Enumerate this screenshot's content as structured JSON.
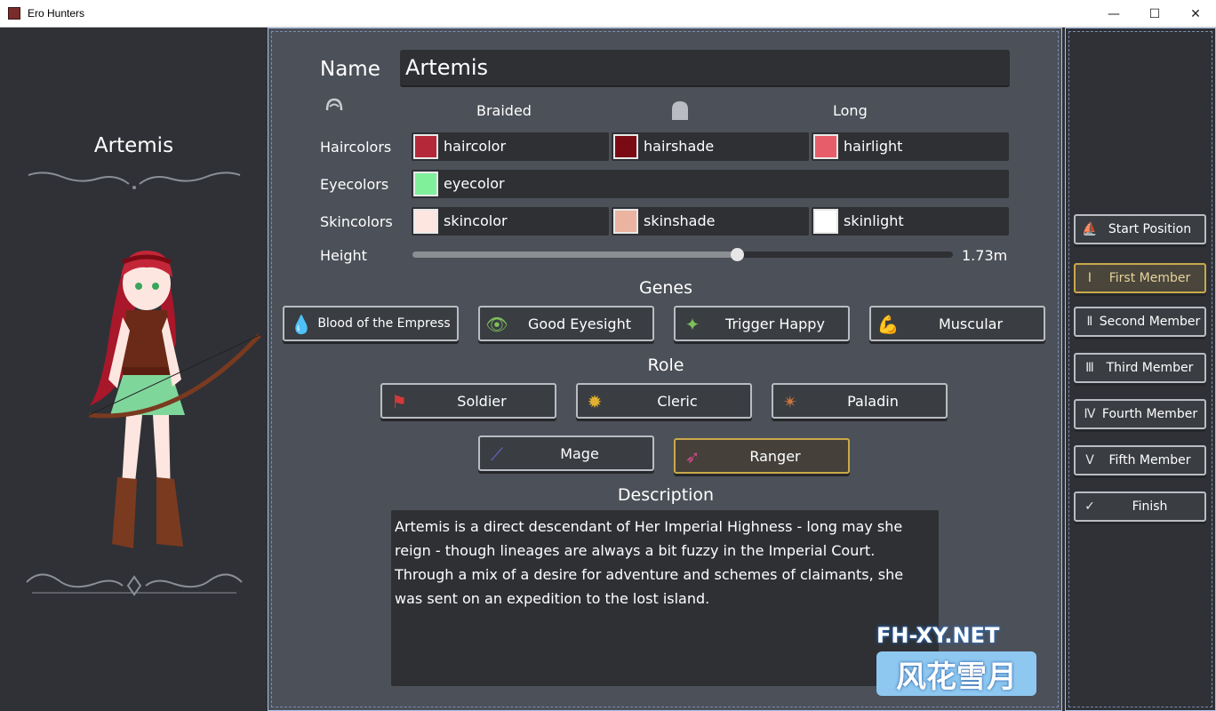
{
  "window": {
    "title": "Ero Hunters",
    "minimize": "—",
    "maximize": "☐",
    "close": "✕"
  },
  "left": {
    "character_name": "Artemis"
  },
  "form": {
    "name_label": "Name",
    "name_value": "Artemis",
    "hair_style_front": "Braided",
    "hair_style_back": "Long",
    "haircolors_label": "Haircolors",
    "haircolor": {
      "label": "haircolor",
      "color": "#b5283a"
    },
    "hairshade": {
      "label": "hairshade",
      "color": "#7a0b14"
    },
    "hairlight": {
      "label": "hairlight",
      "color": "#e85d6a"
    },
    "eyecolors_label": "Eyecolors",
    "eyecolor": {
      "label": "eyecolor",
      "color": "#80f09a"
    },
    "skincolors_label": "Skincolors",
    "skincolor": {
      "label": "skincolor",
      "color": "#fde6e0"
    },
    "skinshade": {
      "label": "skinshade",
      "color": "#eab4a0"
    },
    "skinlight": {
      "label": "skinlight",
      "color": "#ffffff"
    },
    "height_label": "Height",
    "height_value": "1.73m",
    "height_fraction": 0.6
  },
  "genes": {
    "title": "Genes",
    "items": [
      {
        "label": "Blood of the Empress",
        "icon": "blood-drop-icon",
        "color": "#4a8fe0"
      },
      {
        "label": "Good Eyesight",
        "icon": "eye-icon",
        "color": "#7ec05a"
      },
      {
        "label": "Trigger Happy",
        "icon": "pistol-icon",
        "color": "#7ec05a"
      },
      {
        "label": "Muscular",
        "icon": "arm-icon",
        "color": "#c9ccd1"
      }
    ]
  },
  "role": {
    "title": "Role",
    "items": [
      {
        "label": "Soldier",
        "icon": "banner-icon",
        "color": "#d03a3a"
      },
      {
        "label": "Cleric",
        "icon": "sun-icon",
        "color": "#e0b030"
      },
      {
        "label": "Paladin",
        "icon": "cross-sun-icon",
        "color": "#d0783a"
      },
      {
        "label": "Mage",
        "icon": "staff-icon",
        "color": "#6a6ad8"
      },
      {
        "label": "Ranger",
        "icon": "bow-icon",
        "color": "#d04a8a",
        "selected": true
      }
    ]
  },
  "description": {
    "title": "Description",
    "text": "Artemis is a direct descendant of Her Imperial Highness - long may she reign - though lineages are always a bit fuzzy in the Imperial Court. Through a mix of a desire for adventure and schemes of claimants, she was sent on an expedition to the lost island."
  },
  "party": {
    "items": [
      {
        "label": "Start Position",
        "icon": "ship-icon"
      },
      {
        "label": "First Member",
        "icon": "numeral-i-icon",
        "selected": true
      },
      {
        "label": "Second Member",
        "icon": "numeral-ii-icon"
      },
      {
        "label": "Third Member",
        "icon": "numeral-iii-icon"
      },
      {
        "label": "Fourth Member",
        "icon": "numeral-iv-icon"
      },
      {
        "label": "Fifth Member",
        "icon": "numeral-v-icon"
      },
      {
        "label": "Finish",
        "icon": "checkmark-icon"
      }
    ]
  },
  "watermark": {
    "top": "FH-XY.NET",
    "bottom": "风花雪月"
  }
}
